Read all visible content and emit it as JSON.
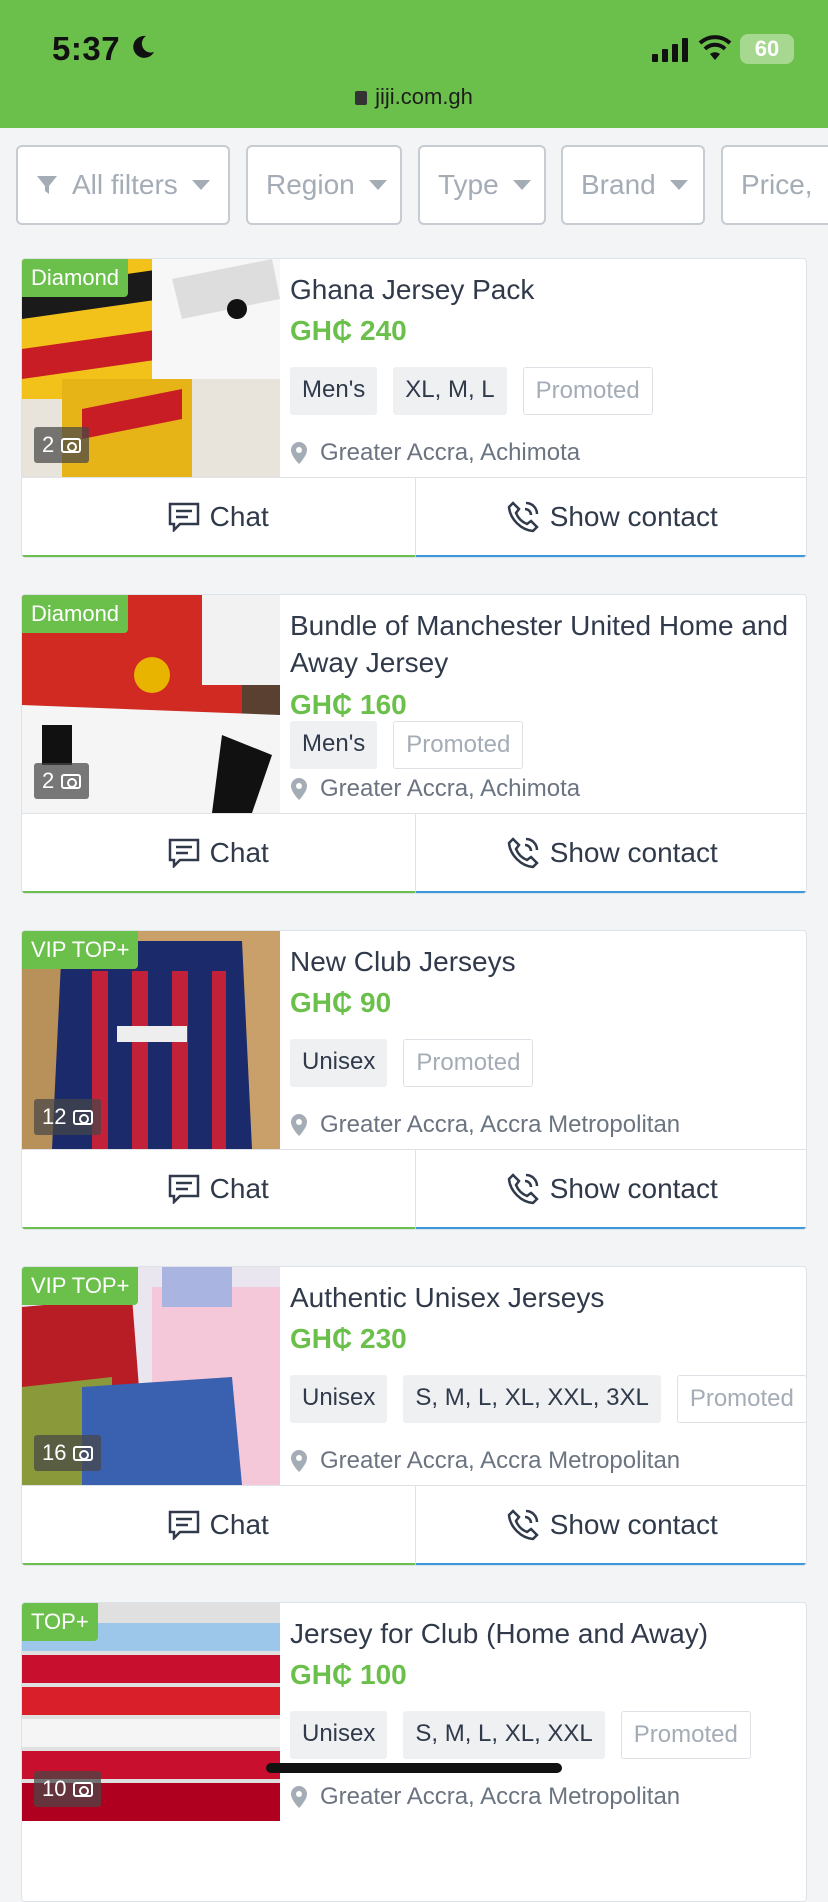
{
  "status": {
    "time": "5:37",
    "battery": "60",
    "url": "jiji.com.gh"
  },
  "filters": [
    "All filters",
    "Region",
    "Type",
    "Brand",
    "Price,"
  ],
  "colors": {
    "accent": "#6bc04b",
    "contact": "#3a98db"
  },
  "listings": [
    {
      "badge": "Diamond",
      "photos": "2",
      "title": "Ghana Jersey Pack",
      "price": "GH₵ 240",
      "tags": [
        "Men's",
        "XL, M, L"
      ],
      "promoted": "Promoted",
      "location": "Greater Accra, Achimota"
    },
    {
      "badge": "Diamond",
      "photos": "2",
      "title": "Bundle of Manchester United Home and Away Jersey",
      "price": "GH₵ 160",
      "tags": [
        "Men's"
      ],
      "promoted": "Promoted",
      "location": "Greater Accra, Achimota"
    },
    {
      "badge": "VIP TOP+",
      "photos": "12",
      "title": "New Club Jerseys",
      "price": "GH₵ 90",
      "tags": [
        "Unisex"
      ],
      "promoted": "Promoted",
      "location": "Greater Accra, Accra Metropolitan"
    },
    {
      "badge": "VIP TOP+",
      "photos": "16",
      "title": "Authentic Unisex Jerseys",
      "price": "GH₵ 230",
      "tags": [
        "Unisex",
        "S, M, L, XL, XXL, 3XL"
      ],
      "promoted": "Promoted",
      "location": "Greater Accra, Accra Metropolitan"
    },
    {
      "badge": "TOP+",
      "photos": "10",
      "title": "Jersey for Club (Home and Away)",
      "price": "GH₵ 100",
      "tags": [
        "Unisex",
        "S, M, L, XL, XXL"
      ],
      "promoted": "Promoted",
      "location": "Greater Accra, Accra Metropolitan"
    }
  ],
  "actions": {
    "chat": "Chat",
    "contact": "Show contact"
  }
}
